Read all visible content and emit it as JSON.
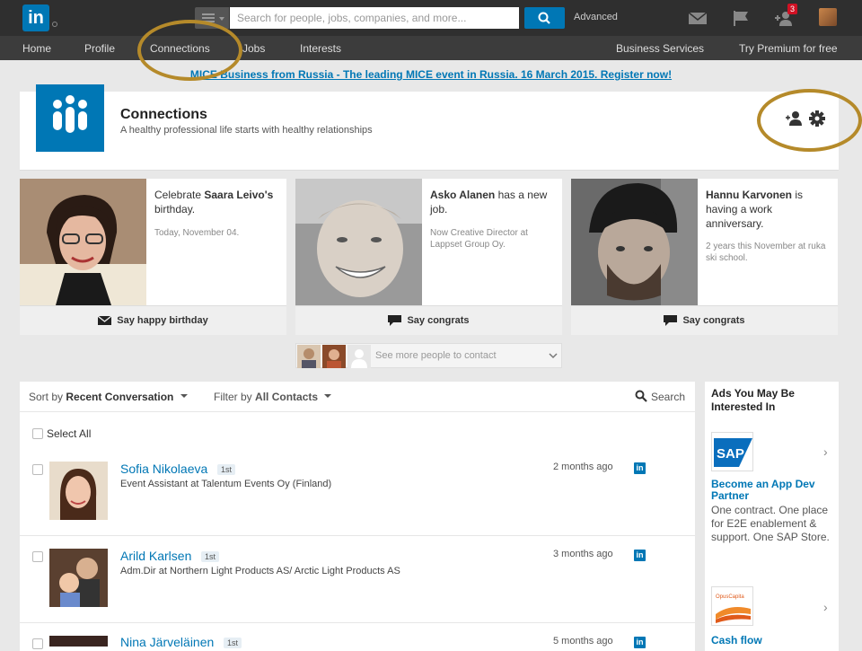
{
  "topbar": {
    "logo": "in",
    "search_placeholder": "Search for people, jobs, companies, and more...",
    "advanced_label": "Advanced",
    "notifications_badge": "3"
  },
  "nav": {
    "home": "Home",
    "profile": "Profile",
    "connections": "Connections",
    "jobs": "Jobs",
    "interests": "Interests",
    "business": "Business Services",
    "premium": "Try Premium for free"
  },
  "promo": "MICE Business from Russia - The leading MICE event in Russia. 16 March 2015. Register now!",
  "header": {
    "title": "Connections",
    "subtitle": "A healthy professional life starts with healthy relationships"
  },
  "cards": [
    {
      "pre": "Celebrate ",
      "name": "Saara Leivo's",
      "post": " birthday.",
      "meta": "Today, November 04.",
      "action": "Say happy birthday"
    },
    {
      "pre": "",
      "name": "Asko Alanen",
      "post": " has a new job.",
      "meta": "Now Creative Director at Lappset Group Oy.",
      "action": "Say congrats"
    },
    {
      "pre": "",
      "name": "Hannu Karvonen",
      "post": " is having a work anniversary.",
      "meta": "2 years this November at ruka ski school.",
      "action": "Say congrats"
    }
  ],
  "more_people": "See more people to contact",
  "list": {
    "sort_label": "Sort by",
    "sort_value": "Recent Conversation",
    "filter_label": "Filter by",
    "filter_value": "All Contacts",
    "search_label": "Search",
    "select_all": "Select All",
    "rows": [
      {
        "name": "Sofia Nikolaeva",
        "degree": "1st",
        "title": "Event Assistant at Talentum Events Oy (Finland)",
        "time": "2 months ago"
      },
      {
        "name": "Arild Karlsen",
        "degree": "1st",
        "title": "Adm.Dir at Northern Light Products AS/ Arctic Light Products AS",
        "time": "3 months ago"
      },
      {
        "name": "Nina Järveläinen",
        "degree": "1st",
        "title": "",
        "time": "5 months ago"
      }
    ]
  },
  "ads": {
    "title": "Ads You May Be Interested In",
    "items": [
      {
        "logo": "SAP",
        "headline": "Become an App Dev Partner",
        "body": "One contract. One place for E2E enablement & support. One SAP Store."
      },
      {
        "logo": "OpusCapita",
        "headline": "Cash flow",
        "body": ""
      }
    ]
  },
  "colors": {
    "brand": "#0077b5",
    "topbar": "#2f2f2f",
    "annotation_ring": "#b58a2a"
  }
}
